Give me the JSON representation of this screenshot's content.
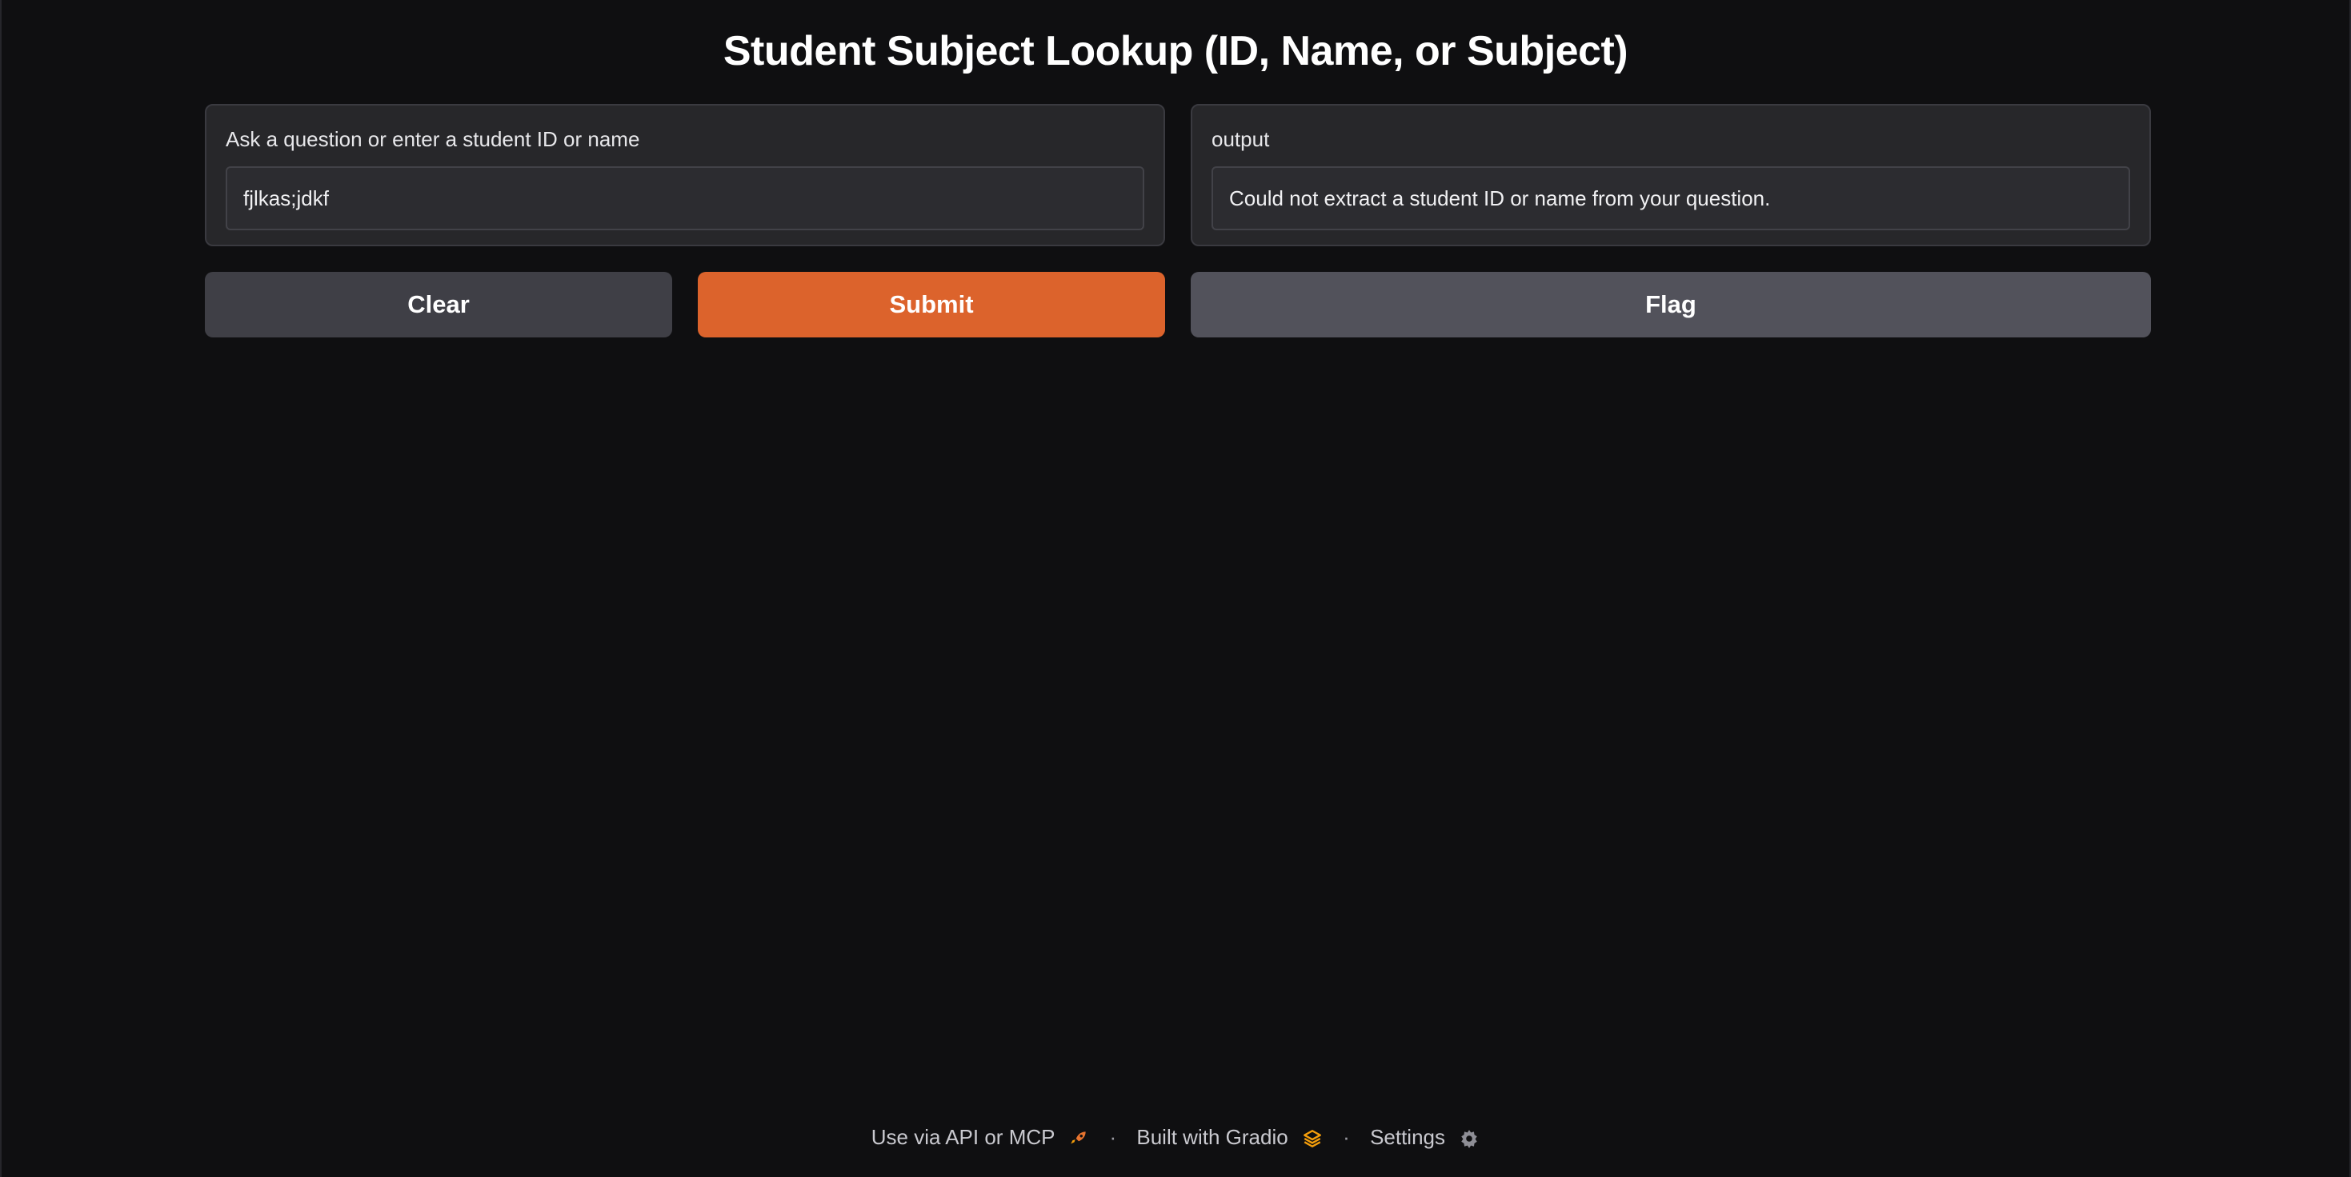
{
  "page": {
    "title": "Student Subject Lookup (ID, Name, or Subject)"
  },
  "input_panel": {
    "label": "Ask a question or enter a student ID or name",
    "value": "fjlkas;jdkf"
  },
  "output_panel": {
    "label": "output",
    "value": "Could not extract a student ID or name from your question."
  },
  "buttons": {
    "clear_label": "Clear",
    "submit_label": "Submit",
    "flag_label": "Flag"
  },
  "footer": {
    "api_label": "Use via API or MCP",
    "api_icon": "rocket-icon",
    "built_label": "Built with Gradio",
    "built_icon": "gradio-logo-icon",
    "settings_label": "Settings",
    "settings_icon": "gear-icon",
    "separator": "·"
  },
  "colors": {
    "background": "#0f0f11",
    "panel": "#27272a",
    "submit_accent": "#dc632c",
    "clear_button": "#3f3f46",
    "flag_button": "#52525b",
    "gradio_orange": "#f59e0b"
  }
}
